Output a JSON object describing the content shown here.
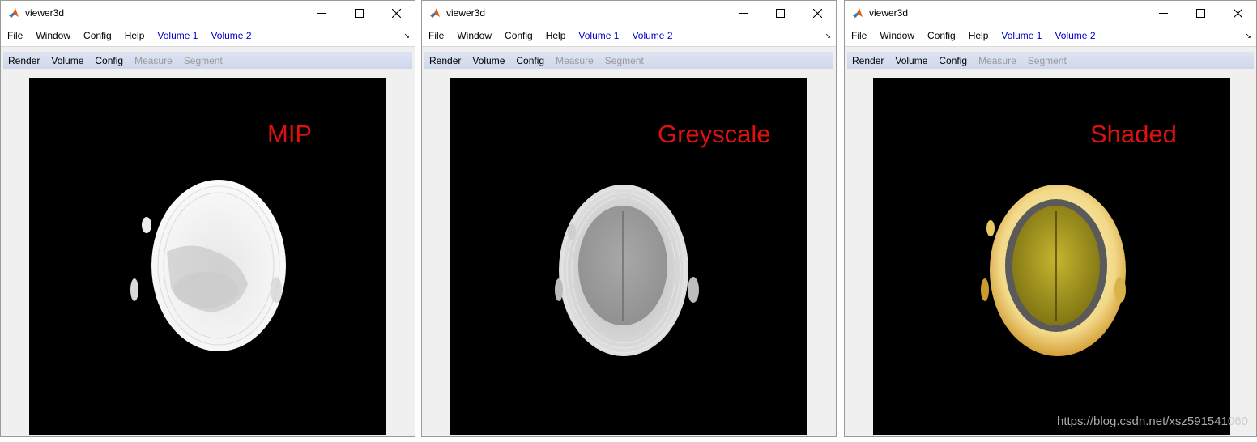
{
  "windows": [
    {
      "title": "viewer3d",
      "menu": [
        "File",
        "Window",
        "Config",
        "Help",
        "Volume 1",
        "Volume 2"
      ],
      "toolbar": [
        "Render",
        "Volume",
        "Config",
        "Measure",
        "Segment"
      ],
      "render_mode": "MIP"
    },
    {
      "title": "viewer3d",
      "menu": [
        "File",
        "Window",
        "Config",
        "Help",
        "Volume 1",
        "Volume 2"
      ],
      "toolbar": [
        "Render",
        "Volume",
        "Config",
        "Measure",
        "Segment"
      ],
      "render_mode": "Greyscale"
    },
    {
      "title": "viewer3d",
      "menu": [
        "File",
        "Window",
        "Config",
        "Help",
        "Volume 1",
        "Volume 2"
      ],
      "toolbar": [
        "Render",
        "Volume",
        "Config",
        "Measure",
        "Segment"
      ],
      "render_mode": "Shaded"
    }
  ],
  "icons": {
    "app": "matlab-icon",
    "minimize": "minimize-icon",
    "maximize": "maximize-icon",
    "close": "close-icon",
    "dock": "dock-arrow-icon"
  },
  "colors": {
    "volume_menu": "#0000cc",
    "render_label": "#e01010",
    "disabled_tool": "#9a9a9a",
    "viewport_bg": "#000000"
  },
  "watermark": "https://blog.csdn.net/xsz591541060"
}
